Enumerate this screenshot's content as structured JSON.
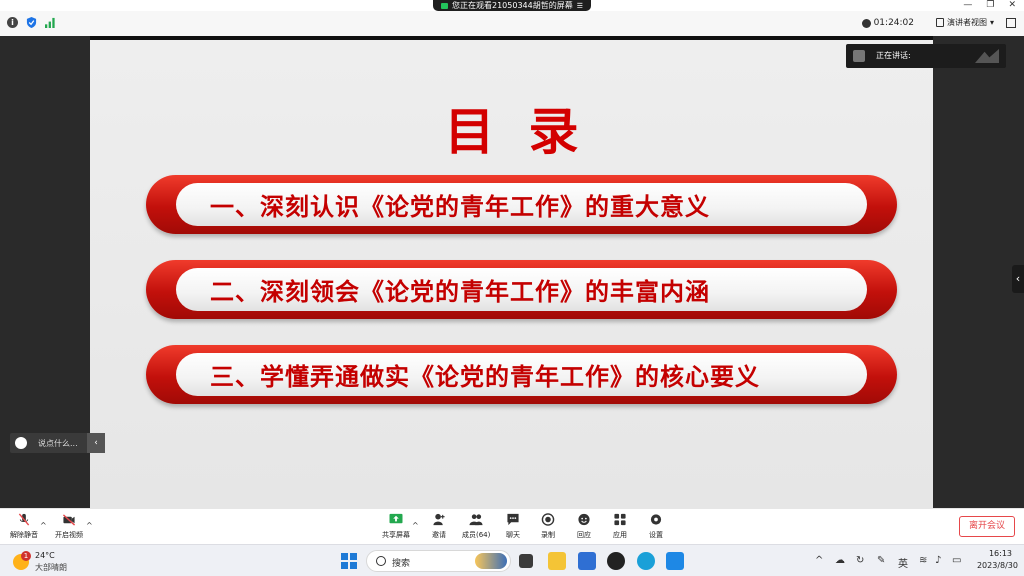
{
  "banner": {
    "text": "您正在观看21050344胡哲的屏幕"
  },
  "titlebar": {
    "timer": "01:24:02",
    "view_label": "演讲者视图"
  },
  "slide": {
    "title": "目录",
    "items": [
      "一、深刻认识《论党的青年工作》的重大意义",
      "二、深刻领会《论党的青年工作》的丰富内涵",
      "三、学懂弄通做实《论党的青年工作》的核心要义"
    ]
  },
  "speaker": {
    "label": "正在讲话:"
  },
  "chat": {
    "placeholder": "说点什么..."
  },
  "toolbar": {
    "unmute": "解除静音",
    "start_video": "开启视频",
    "share": "共享屏幕",
    "invite": "邀请",
    "members": "成员(64)",
    "chat": "聊天",
    "record": "录制",
    "reactions": "回应",
    "apps": "应用",
    "settings": "设置",
    "leave": "离开会议"
  },
  "taskbar": {
    "weather_badge": "1",
    "temperature": "24°C",
    "weather_desc": "大部晴朗",
    "search_placeholder": "搜索",
    "ime": "英",
    "time": "16:13",
    "date": "2023/8/30"
  },
  "colors": {
    "accent_red": "#c40000",
    "share_green": "#23c35c",
    "leave_red": "#e6474a"
  }
}
